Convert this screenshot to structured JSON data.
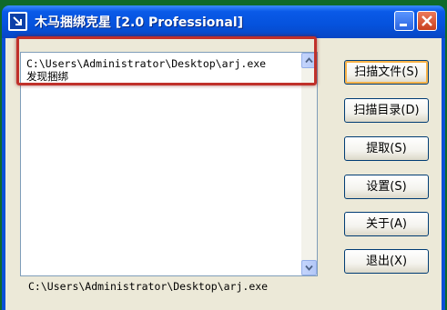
{
  "window": {
    "title": "木马捆绑克星 [2.0 Professional]"
  },
  "list": {
    "lines": [
      "C:\\Users\\Administrator\\Desktop\\arj.exe",
      "发现捆绑"
    ]
  },
  "buttons": {
    "scan_file": "扫描文件(S)",
    "scan_dir": "扫描目录(D)",
    "extract": "提取(S)",
    "settings": "设置(S)",
    "about": "关于(A)",
    "exit": "退出(X)"
  },
  "status": {
    "path": "C:\\Users\\Administrator\\Desktop\\arj.exe"
  },
  "colors": {
    "highlight": "#c0302a",
    "titlebar": "#0552dc"
  },
  "icons": {
    "app": "app-arrow-icon",
    "minimize": "minimize-icon",
    "close": "close-icon",
    "scroll_up": "chevron-up-icon",
    "scroll_down": "chevron-down-icon"
  }
}
